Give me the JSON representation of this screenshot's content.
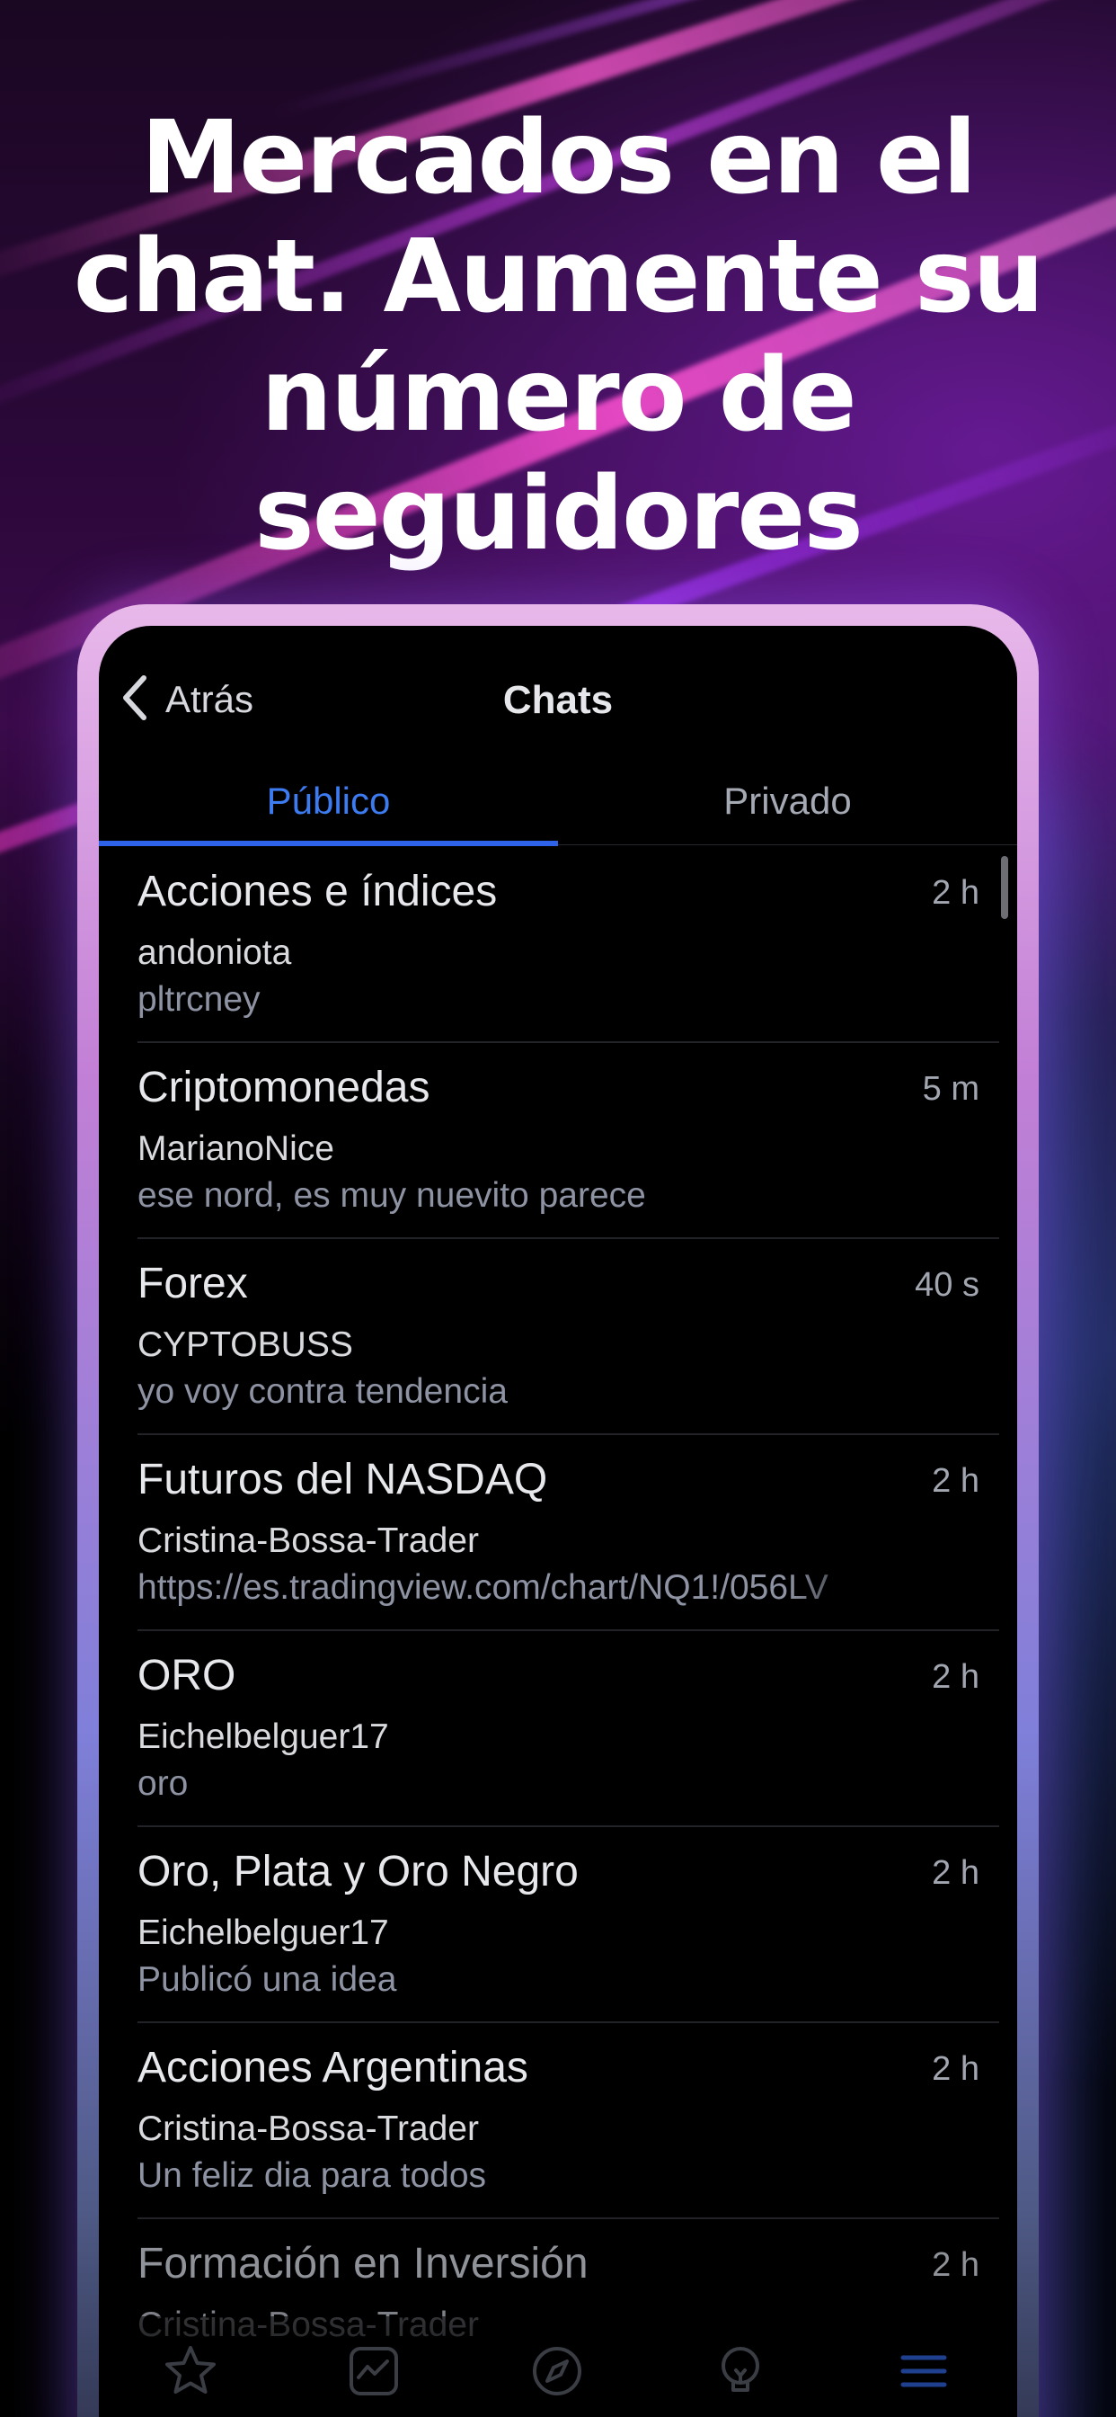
{
  "headline": "Mercados en el chat. Aumente su número de seguidores",
  "colors": {
    "accent": "#3d7bf0",
    "tab_indicator": "#2e62e8",
    "background": "#000000",
    "frame_top": "#e8b8ea",
    "frame_bottom": "#2a2e45"
  },
  "navbar": {
    "back_icon": "chevron-left-icon",
    "back_label": "Atrás",
    "title": "Chats"
  },
  "tabs": {
    "public_label": "Público",
    "private_label": "Privado",
    "selected": "Público"
  },
  "chats": [
    {
      "title": "Acciones e índices",
      "time": "2 h",
      "user": "andoniota",
      "message": "pltrcney"
    },
    {
      "title": "Criptomonedas",
      "time": "5 m",
      "user": "MarianoNice",
      "message": "ese nord, es muy nuevito parece"
    },
    {
      "title": "Forex",
      "time": "40 s",
      "user": "CYPTOBUSS",
      "message": "yo voy contra tendencia"
    },
    {
      "title": "Futuros del NASDAQ",
      "time": "2 h",
      "user": "Cristina-Bossa-Trader",
      "message": "https://es.tradingview.com/chart/NQ1!/056LV"
    },
    {
      "title": "ORO",
      "time": "2 h",
      "user": "Eichelbelguer17",
      "message": "oro"
    },
    {
      "title": "Oro, Plata y Oro Negro",
      "time": "2 h",
      "user": "Eichelbelguer17",
      "message": "Publicó una idea"
    },
    {
      "title": "Acciones Argentinas",
      "time": "2 h",
      "user": "Cristina-Bossa-Trader",
      "message": "Un feliz dia para todos"
    },
    {
      "title": "Formación en Inversión",
      "time": "2 h",
      "user": "Cristina-Bossa-Trader",
      "message": ""
    }
  ],
  "tabbar": {
    "items": [
      "star-icon",
      "chart-icon",
      "compass-icon",
      "lightbulb-icon",
      "menu-icon"
    ],
    "active": "menu-icon"
  }
}
